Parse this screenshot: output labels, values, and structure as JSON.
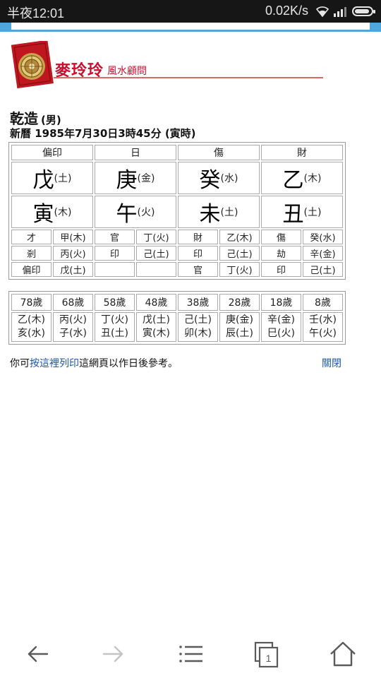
{
  "status_bar": {
    "time": "半夜12:01",
    "network_rate": "0.02K/s",
    "icons": [
      "wifi-icon",
      "signal-icon",
      "battery-icon"
    ]
  },
  "header": {
    "brand_name": "麥玲玲",
    "brand_subtitle": "風水顧問",
    "brand_color": "#c8102e"
  },
  "chart": {
    "title": "乾造",
    "gender": "(男)",
    "birth_line": "新曆 1985年7月30日3時45分 (寅時)",
    "ten_gods_top": [
      "偏印",
      "日",
      "傷",
      "財"
    ],
    "heavenly_stems": [
      {
        "char": "戊",
        "element": "(土)"
      },
      {
        "char": "庚",
        "element": "(金)"
      },
      {
        "char": "癸",
        "element": "(水)"
      },
      {
        "char": "乙",
        "element": "(木)"
      }
    ],
    "earthly_branches": [
      {
        "char": "寅",
        "element": "(木)"
      },
      {
        "char": "午",
        "element": "(火)"
      },
      {
        "char": "未",
        "element": "(土)"
      },
      {
        "char": "丑",
        "element": "(土)"
      }
    ],
    "hidden_rows": [
      [
        "才",
        "甲(木)",
        "官",
        "丁(火)",
        "財",
        "乙(木)",
        "傷",
        "癸(水)"
      ],
      [
        "剎",
        "丙(火)",
        "印",
        "己(土)",
        "印",
        "己(土)",
        "劫",
        "辛(金)"
      ],
      [
        "偏印",
        "戊(土)",
        "",
        "",
        "官",
        "丁(火)",
        "印",
        "己(土)"
      ]
    ]
  },
  "luck": {
    "ages": [
      "78歲",
      "68歲",
      "58歲",
      "48歲",
      "38歲",
      "28歲",
      "18歲",
      "8歲"
    ],
    "stems": [
      "乙(木)",
      "丙(火)",
      "丁(火)",
      "戊(土)",
      "己(土)",
      "庚(金)",
      "辛(金)",
      "壬(水)"
    ],
    "branches": [
      "亥(水)",
      "子(水)",
      "丑(土)",
      "寅(木)",
      "卯(木)",
      "辰(土)",
      "巳(火)",
      "午(火)"
    ]
  },
  "footer_note": {
    "prefix": "你可",
    "link_text": "按這裡列印",
    "suffix": "這網頁以作日後參考。",
    "close_label": "關閉"
  },
  "bottom_nav": {
    "buttons": [
      "back-icon",
      "forward-icon",
      "menu-icon",
      "tabs-icon",
      "home-icon"
    ],
    "tab_count": "1"
  }
}
